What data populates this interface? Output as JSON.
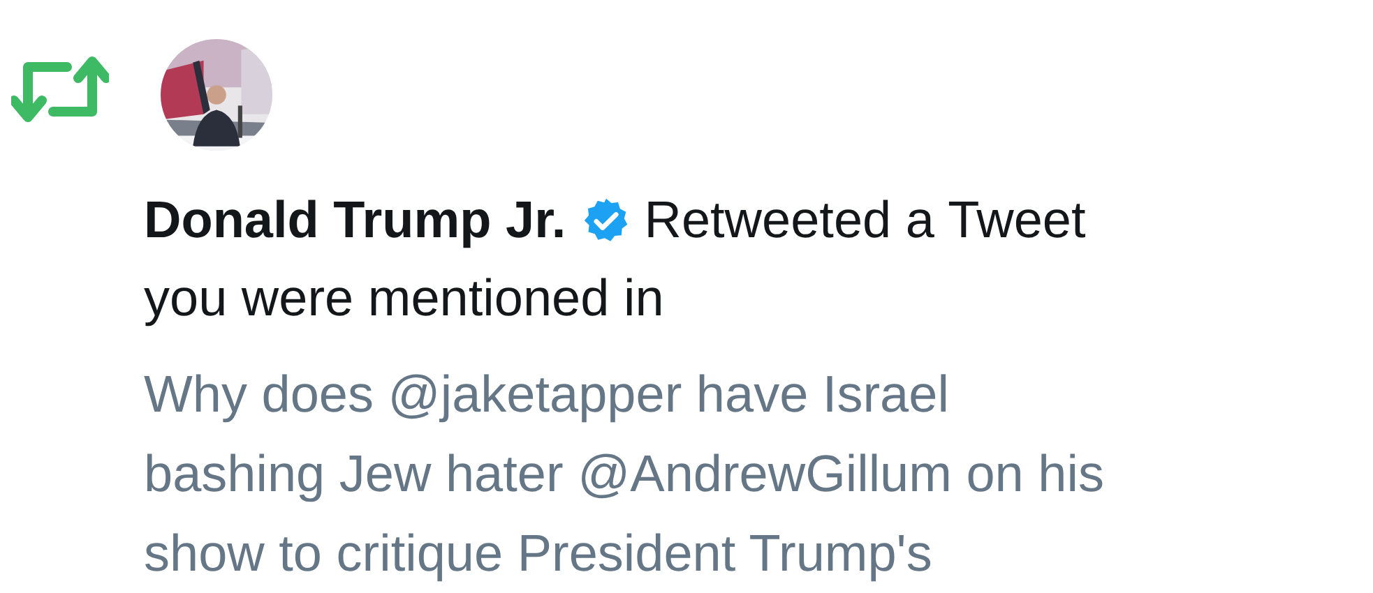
{
  "notification": {
    "kind": "retweet",
    "user": {
      "name": "Donald Trump Jr.",
      "verified": true
    },
    "action_lines": [
      "Retweeted a Tweet",
      "you were mentioned in"
    ],
    "tweet_lines": [
      "Why does @jaketapper have Israel",
      "bashing Jew hater @AndrewGillum on his",
      "show to critique President Trump's"
    ]
  }
}
